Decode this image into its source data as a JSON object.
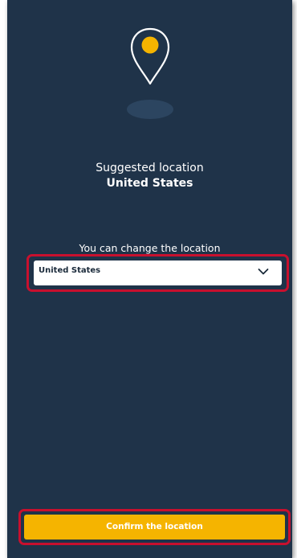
{
  "suggestion": {
    "label": "Suggested location",
    "value": "United States"
  },
  "location_picker": {
    "label": "You can change the location",
    "selected": "United States",
    "chevron_icon": "chevron-down-icon"
  },
  "confirm_button": {
    "label": "Confirm the location"
  },
  "illustration": {
    "icon": "location-pin-icon"
  },
  "colors": {
    "background": "#1f3349",
    "accent": "#f5b400",
    "highlight": "#c8102e"
  }
}
